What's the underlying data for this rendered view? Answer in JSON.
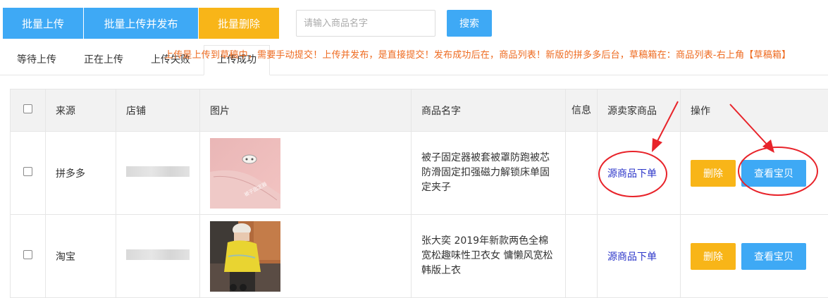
{
  "toolbar": {
    "batch_upload": "批量上传",
    "batch_upload_publish": "批量上传并发布",
    "batch_delete": "批量删除",
    "search_placeholder": "请输入商品名字",
    "search_label": "搜索"
  },
  "tabs": [
    {
      "label": "等待上传",
      "active": false
    },
    {
      "label": "正在上传",
      "active": false
    },
    {
      "label": "上传失败",
      "active": false
    },
    {
      "label": "上传成功",
      "active": true
    }
  ],
  "notice": "上传是上传到草稿中，需要手动提交！上传并发布，是直接提交！发布成功后在，商品列表！新版的拼多多后台，草稿箱在：商品列表-右上角【草稿箱】",
  "table": {
    "headers": {
      "source": "来源",
      "shop": "店铺",
      "image": "图片",
      "name": "商品名字",
      "info": "信息",
      "seller": "源卖家商品",
      "ops": "操作"
    },
    "rows": [
      {
        "source": "拼多多",
        "name": "被子固定器被套被罩防跑被芯防滑固定扣强磁力解锁床单固定夹子",
        "seller_link": "源商品下单",
        "delete_label": "删除",
        "view_label": "查看宝贝",
        "thumb_caption": "被子固定器"
      },
      {
        "source": "淘宝",
        "name": "张大奕 2019年新款两色全棉宽松趣味性卫衣女 慵懒风宽松韩版上衣",
        "seller_link": "源商品下单",
        "delete_label": "删除",
        "view_label": "查看宝贝"
      }
    ]
  },
  "colors": {
    "primary_blue": "#3ea9f5",
    "accent_orange": "#f8b518",
    "notice_orange": "#ee6a1f",
    "link_blue": "#2b35c9",
    "annotation_red": "#e8232a"
  }
}
